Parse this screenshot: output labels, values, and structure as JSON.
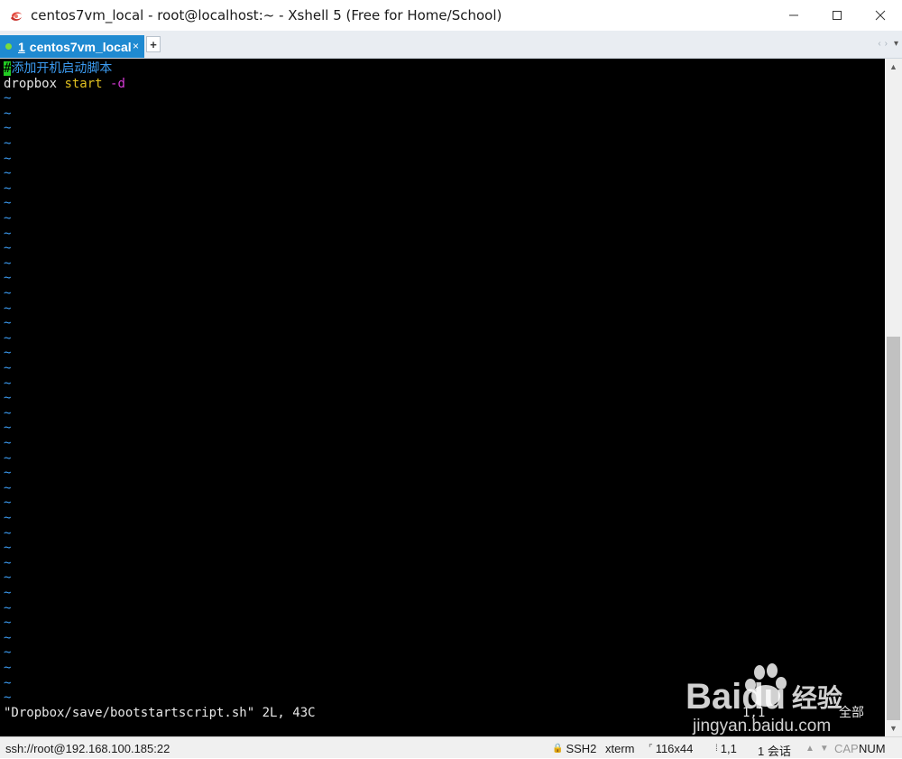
{
  "window": {
    "title": "centos7vm_local - root@localhost:~ - Xshell 5 (Free for Home/School)",
    "controls": {
      "minimize": "minimize-icon",
      "maximize": "maximize-icon",
      "close": "close-icon"
    }
  },
  "tabs": {
    "active": {
      "number": "1",
      "label": "centos7vm_local",
      "close": "×"
    },
    "add": "+",
    "nav_prev": "‹",
    "nav_next": "›",
    "menu": "▾"
  },
  "terminal": {
    "lines": [
      {
        "parts": [
          {
            "text": "#",
            "cls": "cursor"
          },
          {
            "text": "添加开机启动脚本",
            "cls": "c-comment"
          }
        ]
      },
      {
        "parts": [
          {
            "text": "dropbox ",
            "cls": "c-white"
          },
          {
            "text": "start",
            "cls": "c-yellow"
          },
          {
            "text": " ",
            "cls": "c-white"
          },
          {
            "text": "-d",
            "cls": "c-magenta"
          }
        ]
      }
    ],
    "tilde": "~",
    "tilde_count": 41,
    "status_message": "\"Dropbox/save/bootstartscript.sh\" 2L, 43C",
    "ruler_pos": "1,1",
    "ruler_all": "全部"
  },
  "statusbar": {
    "connection": "ssh://root@192.168.100.185:22",
    "protocol": "SSH2",
    "term_type": "xterm",
    "size": "116x44",
    "cursor_pos": "1,1",
    "sessions": "1 会话",
    "cap": "CAP",
    "num": "NUM"
  },
  "watermark": {
    "brand": "Baidu",
    "brand_cn": "经验",
    "url": "jingyan.baidu.com"
  }
}
